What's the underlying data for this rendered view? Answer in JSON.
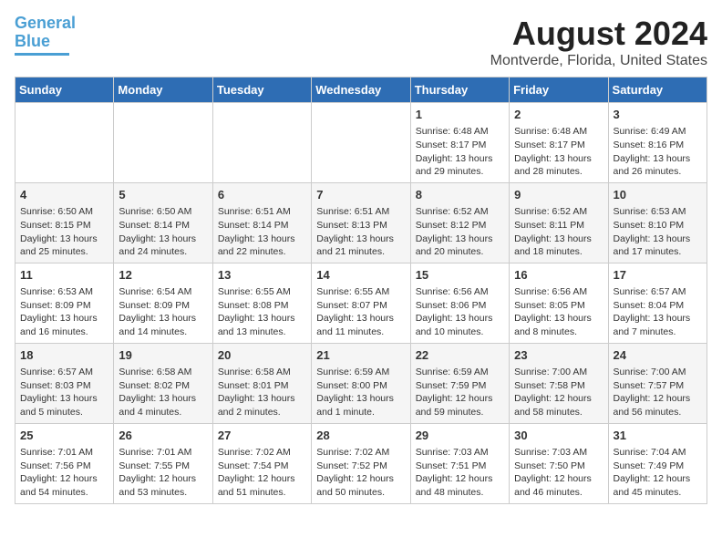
{
  "logo": {
    "line1": "General",
    "line2": "Blue"
  },
  "title": "August 2024",
  "subtitle": "Montverde, Florida, United States",
  "days_of_week": [
    "Sunday",
    "Monday",
    "Tuesday",
    "Wednesday",
    "Thursday",
    "Friday",
    "Saturday"
  ],
  "weeks": [
    [
      {
        "day": "",
        "info": ""
      },
      {
        "day": "",
        "info": ""
      },
      {
        "day": "",
        "info": ""
      },
      {
        "day": "",
        "info": ""
      },
      {
        "day": "1",
        "info": "Sunrise: 6:48 AM\nSunset: 8:17 PM\nDaylight: 13 hours\nand 29 minutes."
      },
      {
        "day": "2",
        "info": "Sunrise: 6:48 AM\nSunset: 8:17 PM\nDaylight: 13 hours\nand 28 minutes."
      },
      {
        "day": "3",
        "info": "Sunrise: 6:49 AM\nSunset: 8:16 PM\nDaylight: 13 hours\nand 26 minutes."
      }
    ],
    [
      {
        "day": "4",
        "info": "Sunrise: 6:50 AM\nSunset: 8:15 PM\nDaylight: 13 hours\nand 25 minutes."
      },
      {
        "day": "5",
        "info": "Sunrise: 6:50 AM\nSunset: 8:14 PM\nDaylight: 13 hours\nand 24 minutes."
      },
      {
        "day": "6",
        "info": "Sunrise: 6:51 AM\nSunset: 8:14 PM\nDaylight: 13 hours\nand 22 minutes."
      },
      {
        "day": "7",
        "info": "Sunrise: 6:51 AM\nSunset: 8:13 PM\nDaylight: 13 hours\nand 21 minutes."
      },
      {
        "day": "8",
        "info": "Sunrise: 6:52 AM\nSunset: 8:12 PM\nDaylight: 13 hours\nand 20 minutes."
      },
      {
        "day": "9",
        "info": "Sunrise: 6:52 AM\nSunset: 8:11 PM\nDaylight: 13 hours\nand 18 minutes."
      },
      {
        "day": "10",
        "info": "Sunrise: 6:53 AM\nSunset: 8:10 PM\nDaylight: 13 hours\nand 17 minutes."
      }
    ],
    [
      {
        "day": "11",
        "info": "Sunrise: 6:53 AM\nSunset: 8:09 PM\nDaylight: 13 hours\nand 16 minutes."
      },
      {
        "day": "12",
        "info": "Sunrise: 6:54 AM\nSunset: 8:09 PM\nDaylight: 13 hours\nand 14 minutes."
      },
      {
        "day": "13",
        "info": "Sunrise: 6:55 AM\nSunset: 8:08 PM\nDaylight: 13 hours\nand 13 minutes."
      },
      {
        "day": "14",
        "info": "Sunrise: 6:55 AM\nSunset: 8:07 PM\nDaylight: 13 hours\nand 11 minutes."
      },
      {
        "day": "15",
        "info": "Sunrise: 6:56 AM\nSunset: 8:06 PM\nDaylight: 13 hours\nand 10 minutes."
      },
      {
        "day": "16",
        "info": "Sunrise: 6:56 AM\nSunset: 8:05 PM\nDaylight: 13 hours\nand 8 minutes."
      },
      {
        "day": "17",
        "info": "Sunrise: 6:57 AM\nSunset: 8:04 PM\nDaylight: 13 hours\nand 7 minutes."
      }
    ],
    [
      {
        "day": "18",
        "info": "Sunrise: 6:57 AM\nSunset: 8:03 PM\nDaylight: 13 hours\nand 5 minutes."
      },
      {
        "day": "19",
        "info": "Sunrise: 6:58 AM\nSunset: 8:02 PM\nDaylight: 13 hours\nand 4 minutes."
      },
      {
        "day": "20",
        "info": "Sunrise: 6:58 AM\nSunset: 8:01 PM\nDaylight: 13 hours\nand 2 minutes."
      },
      {
        "day": "21",
        "info": "Sunrise: 6:59 AM\nSunset: 8:00 PM\nDaylight: 13 hours\nand 1 minute."
      },
      {
        "day": "22",
        "info": "Sunrise: 6:59 AM\nSunset: 7:59 PM\nDaylight: 12 hours\nand 59 minutes."
      },
      {
        "day": "23",
        "info": "Sunrise: 7:00 AM\nSunset: 7:58 PM\nDaylight: 12 hours\nand 58 minutes."
      },
      {
        "day": "24",
        "info": "Sunrise: 7:00 AM\nSunset: 7:57 PM\nDaylight: 12 hours\nand 56 minutes."
      }
    ],
    [
      {
        "day": "25",
        "info": "Sunrise: 7:01 AM\nSunset: 7:56 PM\nDaylight: 12 hours\nand 54 minutes."
      },
      {
        "day": "26",
        "info": "Sunrise: 7:01 AM\nSunset: 7:55 PM\nDaylight: 12 hours\nand 53 minutes."
      },
      {
        "day": "27",
        "info": "Sunrise: 7:02 AM\nSunset: 7:54 PM\nDaylight: 12 hours\nand 51 minutes."
      },
      {
        "day": "28",
        "info": "Sunrise: 7:02 AM\nSunset: 7:52 PM\nDaylight: 12 hours\nand 50 minutes."
      },
      {
        "day": "29",
        "info": "Sunrise: 7:03 AM\nSunset: 7:51 PM\nDaylight: 12 hours\nand 48 minutes."
      },
      {
        "day": "30",
        "info": "Sunrise: 7:03 AM\nSunset: 7:50 PM\nDaylight: 12 hours\nand 46 minutes."
      },
      {
        "day": "31",
        "info": "Sunrise: 7:04 AM\nSunset: 7:49 PM\nDaylight: 12 hours\nand 45 minutes."
      }
    ]
  ]
}
